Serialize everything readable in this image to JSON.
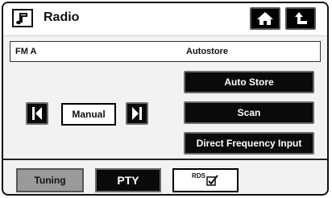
{
  "header": {
    "title": "Radio",
    "icon": "music-note-icon",
    "home_icon": "home-icon",
    "back_icon": "back-arrow-icon"
  },
  "info_bar": {
    "band": "FM A",
    "mode": "Autostore"
  },
  "controls": {
    "prev_icon": "skip-previous-icon",
    "manual_label": "Manual",
    "next_icon": "skip-next-icon",
    "auto_store_label": "Auto Store",
    "scan_label": "Scan",
    "direct_freq_label": "Direct Frequency Input"
  },
  "tabs": [
    {
      "label": "Tuning",
      "selected": true
    },
    {
      "label": "PTY",
      "selected": false
    },
    {
      "label": "RDS",
      "selected": false,
      "icon": "checkmark-icon"
    }
  ],
  "colors": {
    "button_bg": "#0a0a0a",
    "selected_tab_bg": "#9a9a9a",
    "panel_bg": "#f2f2f2"
  }
}
